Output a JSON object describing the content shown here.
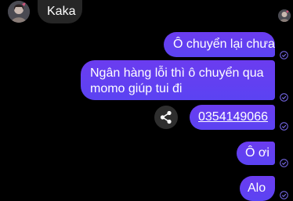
{
  "conversation": {
    "incoming": [
      {
        "text": "Kaka"
      }
    ],
    "outgoing": [
      {
        "text": "Ô chuyển lại chưa"
      },
      {
        "line1": "Ngân hàng lỗi thì ô chuyển qua",
        "line2": "momo giúp tui đi"
      },
      {
        "text": "0354149066"
      },
      {
        "text": "Ô ơi"
      },
      {
        "text": "Alo"
      }
    ]
  },
  "colors": {
    "background": "#000000",
    "incoming_bubble": "#262626",
    "outgoing_bubble": "#5f3ff2",
    "seen_check": "#7b6cf0"
  },
  "icons": {
    "share": "share-icon",
    "seen": "check-circle-icon"
  }
}
